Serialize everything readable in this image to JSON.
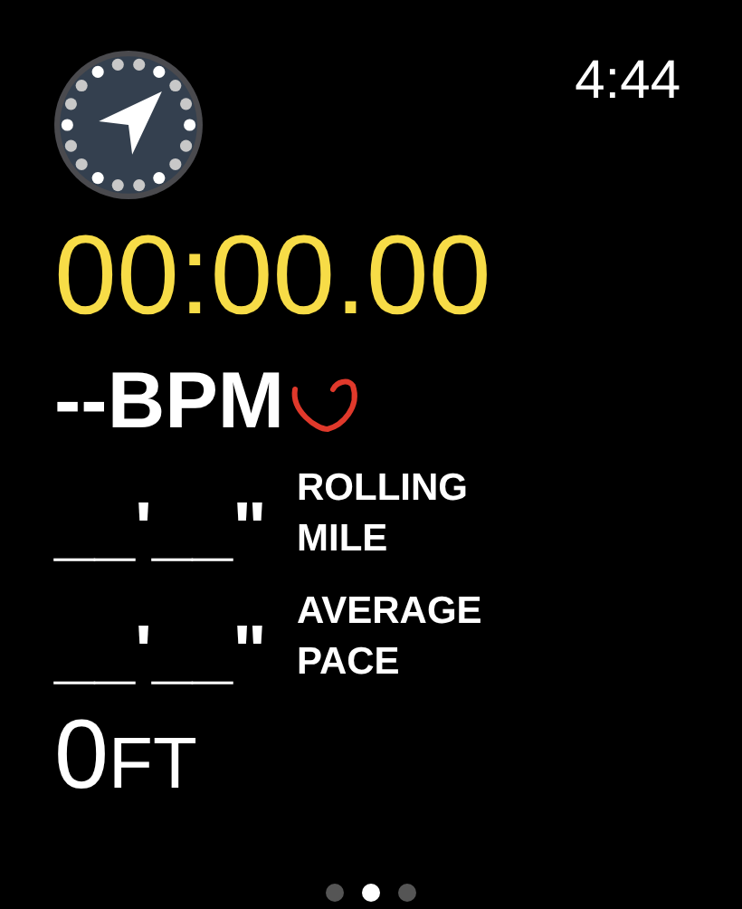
{
  "clock": "4:44",
  "elapsed_time": "00:00.00",
  "heart_rate": {
    "value": "--",
    "unit": "BPM"
  },
  "paces": [
    {
      "value": "__'__\"",
      "label": "ROLLING MILE"
    },
    {
      "value": "__'__\"",
      "label": "AVERAGE PACE"
    }
  ],
  "elevation": {
    "value": "0",
    "unit": "FT"
  },
  "page_dots": [
    {
      "selected": false
    },
    {
      "selected": true
    },
    {
      "selected": false
    }
  ]
}
